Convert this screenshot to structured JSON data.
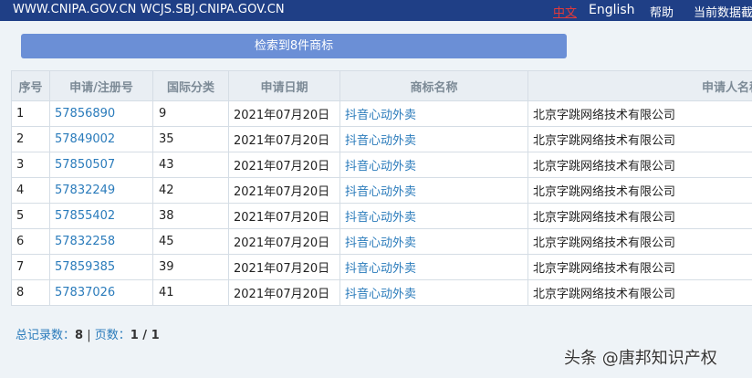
{
  "topbar": {
    "domains": "WWW.CNIPA.GOV.CN WCJS.SBJ.CNIPA.GOV.CN",
    "lang_zh": "中文",
    "lang_en": "English",
    "help": "帮助",
    "update": "当前数据截"
  },
  "search": {
    "result_label": "检索到8件商标"
  },
  "table": {
    "headers": [
      "序号",
      "申请/注册号",
      "国际分类",
      "申请日期",
      "商标名称",
      "申请人名称"
    ],
    "rows": [
      {
        "no": "1",
        "reg": "57856890",
        "cls": "9",
        "date": "2021年07月20日",
        "mark": "抖音心动外卖",
        "applicant": "北京字跳网络技术有限公司"
      },
      {
        "no": "2",
        "reg": "57849002",
        "cls": "35",
        "date": "2021年07月20日",
        "mark": "抖音心动外卖",
        "applicant": "北京字跳网络技术有限公司"
      },
      {
        "no": "3",
        "reg": "57850507",
        "cls": "43",
        "date": "2021年07月20日",
        "mark": "抖音心动外卖",
        "applicant": "北京字跳网络技术有限公司"
      },
      {
        "no": "4",
        "reg": "57832249",
        "cls": "42",
        "date": "2021年07月20日",
        "mark": "抖音心动外卖",
        "applicant": "北京字跳网络技术有限公司"
      },
      {
        "no": "5",
        "reg": "57855402",
        "cls": "38",
        "date": "2021年07月20日",
        "mark": "抖音心动外卖",
        "applicant": "北京字跳网络技术有限公司"
      },
      {
        "no": "6",
        "reg": "57832258",
        "cls": "45",
        "date": "2021年07月20日",
        "mark": "抖音心动外卖",
        "applicant": "北京字跳网络技术有限公司"
      },
      {
        "no": "7",
        "reg": "57859385",
        "cls": "39",
        "date": "2021年07月20日",
        "mark": "抖音心动外卖",
        "applicant": "北京字跳网络技术有限公司"
      },
      {
        "no": "8",
        "reg": "57837026",
        "cls": "41",
        "date": "2021年07月20日",
        "mark": "抖音心动外卖",
        "applicant": "北京字跳网络技术有限公司"
      }
    ]
  },
  "summary": {
    "total_label": "总记录数：",
    "total": "8",
    "sep": " | ",
    "pages_label": "页数：",
    "pages": "1 / 1"
  },
  "watermark": "头条 @唐邦知识产权"
}
